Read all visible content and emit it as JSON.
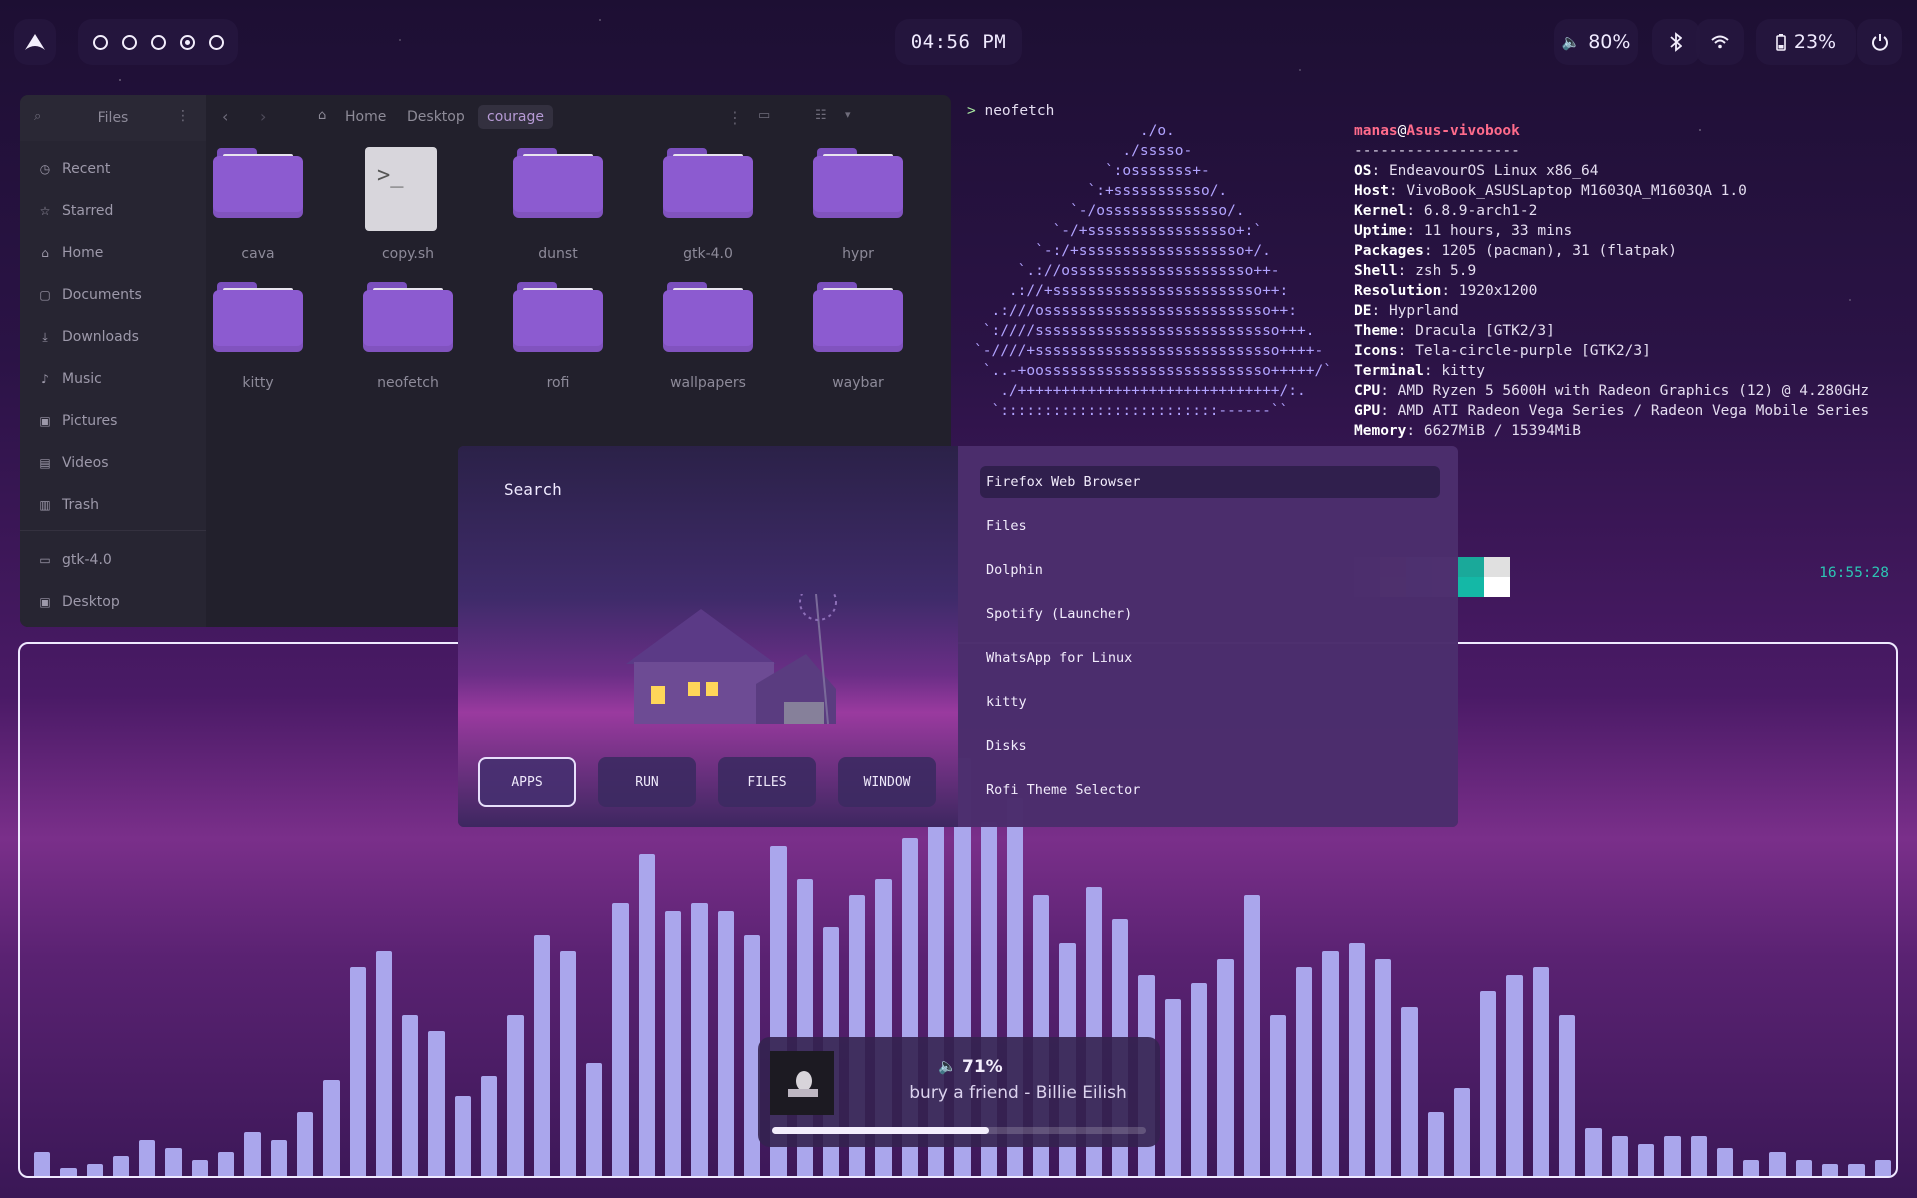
{
  "topbar": {
    "workspaces": [
      false,
      false,
      false,
      true,
      false
    ],
    "clock": "04:56 PM",
    "volume": "80%",
    "battery": "23%"
  },
  "files": {
    "title": "Files",
    "breadcrumbs": [
      "Home",
      "Desktop",
      "courage"
    ],
    "sidebar": [
      {
        "label": "Recent",
        "icon": "clock-icon"
      },
      {
        "label": "Starred",
        "icon": "star-icon"
      },
      {
        "label": "Home",
        "icon": "home-icon"
      },
      {
        "label": "Documents",
        "icon": "document-icon"
      },
      {
        "label": "Downloads",
        "icon": "download-icon"
      },
      {
        "label": "Music",
        "icon": "music-icon"
      },
      {
        "label": "Pictures",
        "icon": "picture-icon"
      },
      {
        "label": "Videos",
        "icon": "video-icon"
      },
      {
        "label": "Trash",
        "icon": "trash-icon"
      },
      {
        "label": "gtk-4.0",
        "icon": "folder-icon"
      },
      {
        "label": "Desktop",
        "icon": "desktop-icon"
      }
    ],
    "items": [
      "cava",
      "copy.sh",
      "dunst",
      "gtk-4.0",
      "hypr",
      "kitty",
      "neofetch",
      "rofi",
      "wallpapers",
      "waybar"
    ],
    "script_glyph": ">_"
  },
  "terminal": {
    "prompt": "> neofetch",
    "ascii": [
      "                   ./o.",
      "                 ./sssso-",
      "               `:osssssss+-",
      "             `:+sssssssssso/.",
      "           `-/ossssssssssssso/.",
      "         `-/+sssssssssssssssso+:`",
      "       `-:/+sssssssssssssssssso+/.",
      "     `.://osssssssssssssssssssso++-",
      "    .://+ssssssssssssssssssssssso++:",
      "  .:///ossssssssssssssssssssssssso++:",
      " `:////ssssssssssssssssssssssssssso+++.",
      "`-////+ssssssssssssssssssssssssssso++++-",
      " `..-+oossssssssssssssssssssssssso+++++/`",
      "   ./++++++++++++++++++++++++++++++/:.",
      "  `:::::::::::::::::::::::::------``"
    ],
    "user": "manas",
    "host": "Asus-vivobook",
    "separator": "-------------------",
    "info": [
      {
        "key": "OS",
        "value": "EndeavourOS Linux x86_64"
      },
      {
        "key": "Host",
        "value": "VivoBook_ASUSLaptop M1603QA_M1603QA 1.0"
      },
      {
        "key": "Kernel",
        "value": "6.8.9-arch1-2"
      },
      {
        "key": "Uptime",
        "value": "11 hours, 33 mins"
      },
      {
        "key": "Packages",
        "value": "1205 (pacman), 31 (flatpak)"
      },
      {
        "key": "Shell",
        "value": "zsh 5.9"
      },
      {
        "key": "Resolution",
        "value": "1920x1200"
      },
      {
        "key": "DE",
        "value": "Hyprland"
      },
      {
        "key": "Theme",
        "value": "Dracula [GTK2/3]"
      },
      {
        "key": "Icons",
        "value": "Tela-circle-purple [GTK2/3]"
      },
      {
        "key": "Terminal",
        "value": "kitty"
      },
      {
        "key": "CPU",
        "value": "AMD Ryzen 5 5600H with Radeon Graphics (12) @ 4.280GHz"
      },
      {
        "key": "GPU",
        "value": "AMD ATI Radeon Vega Series / Radeon Vega Mobile Series"
      },
      {
        "key": "Memory",
        "value": "6627MiB / 15394MiB"
      }
    ],
    "palette_top": [
      "#6f5a8f",
      "#e8a77a",
      "#a8d3f0",
      "#f0c0e8",
      "#1aa99a",
      "#e0e0e0"
    ],
    "palette_bottom": [
      "#6f5a8f",
      "#f4c08f",
      "#bfe2fa",
      "#f6d6f2",
      "#14b8a6",
      "#ffffff"
    ],
    "right_time": "16:55:28"
  },
  "rofi": {
    "search_placeholder": "Search",
    "modes": [
      "APPS",
      "RUN",
      "FILES",
      "WINDOW"
    ],
    "active_mode": 0,
    "entries": [
      "Firefox Web Browser",
      "Files",
      "Dolphin",
      "Spotify (Launcher)",
      "WhatsApp for Linux",
      "kitty",
      "Disks",
      "Rofi Theme Selector"
    ],
    "selected": 0
  },
  "cava": {
    "bar_color": "#aaa6ec",
    "levels": [
      0.03,
      0.01,
      0.015,
      0.025,
      0.045,
      0.035,
      0.02,
      0.03,
      0.055,
      0.045,
      0.08,
      0.12,
      0.26,
      0.28,
      0.2,
      0.18,
      0.1,
      0.125,
      0.2,
      0.3,
      0.28,
      0.14,
      0.34,
      0.4,
      0.33,
      0.34,
      0.33,
      0.3,
      0.41,
      0.37,
      0.31,
      0.35,
      0.37,
      0.42,
      0.51,
      0.52,
      0.44,
      0.47,
      0.35,
      0.29,
      0.36,
      0.32,
      0.25,
      0.22,
      0.24,
      0.27,
      0.35,
      0.2,
      0.26,
      0.28,
      0.29,
      0.27,
      0.21,
      0.08,
      0.11,
      0.23,
      0.25,
      0.26,
      0.2,
      0.06,
      0.05,
      0.04,
      0.05,
      0.05,
      0.035,
      0.02,
      0.03,
      0.02,
      0.015,
      0.015,
      0.02
    ]
  },
  "player": {
    "volume": "71%",
    "track": "bury a friend - Billie Eilish",
    "progress": 0.58
  }
}
